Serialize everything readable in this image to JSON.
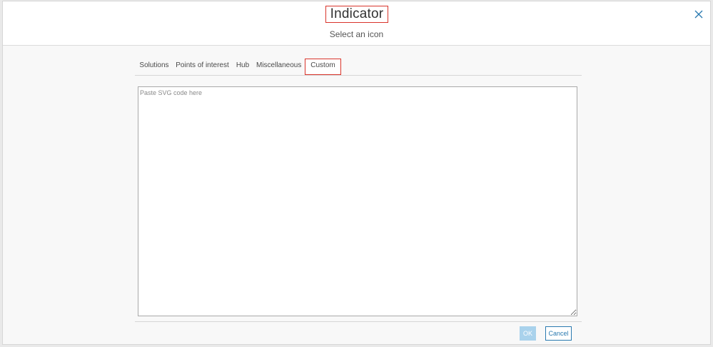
{
  "dialog": {
    "title": "Indicator",
    "subtitle": "Select an icon",
    "close_icon": "close-icon"
  },
  "tabs": [
    {
      "label": "Solutions",
      "active": false
    },
    {
      "label": "Points of interest",
      "active": false
    },
    {
      "label": "Hub",
      "active": false
    },
    {
      "label": "Miscellaneous",
      "active": false
    },
    {
      "label": "Custom",
      "active": true
    }
  ],
  "custom": {
    "placeholder": "Paste SVG code here",
    "value": ""
  },
  "footer": {
    "ok_label": "OK",
    "cancel_label": "Cancel"
  },
  "colors": {
    "highlight": "#d9342b",
    "accent": "#2a7ab0",
    "ok_disabled": "#a9d2ec"
  }
}
